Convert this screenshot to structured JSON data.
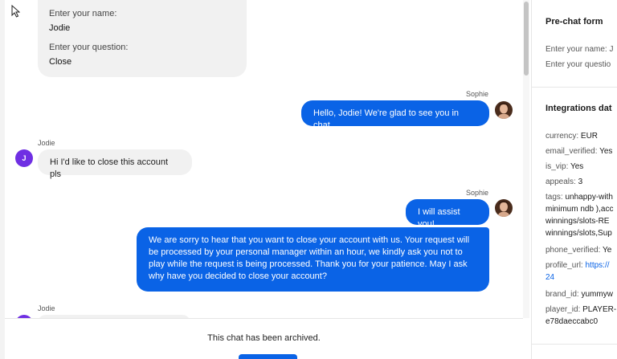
{
  "prechat_bubble": {
    "name_label": "Enter your name:",
    "name_value": "Jodie",
    "question_label": "Enter your question:",
    "question_value": "Close"
  },
  "messages": [
    {
      "sender": "Sophie",
      "text": "Hello, Jodie! We're glad to see you in chat."
    },
    {
      "sender": "Jodie",
      "avatar_letter": "J",
      "text": "Hi I'd like to close this account pls"
    },
    {
      "sender": "Sophie",
      "text": "I will assist you!"
    },
    {
      "text": "We are sorry to hear that you want to close your account with us. Your request will be processed by your personal manager within an hour, we kindly ask you not to play while the request is being processed. Thank you for your patience. May I ask why have you decided to close your account?"
    },
    {
      "sender": "Jodie"
    }
  ],
  "archived": {
    "text": "This chat has been archived."
  },
  "panel": {
    "prechat_title": "Pre-chat form",
    "prechat_lines": [
      "Enter your name: J",
      "Enter your questio"
    ],
    "integrations_title": "Integrations dat",
    "fields": [
      {
        "key": "currency:",
        "value": "EUR"
      },
      {
        "key": "email_verified:",
        "value": "Yes"
      },
      {
        "key": "is_vip:",
        "value": "Yes"
      },
      {
        "key": "appeals:",
        "value": "3"
      },
      {
        "key": "tags:",
        "value": "unhappy-with"
      }
    ],
    "tags_continuation": [
      "minimum ndb ),acc",
      "winnings/slots-RE",
      "winnings/slots,Sup"
    ],
    "phone_verified": {
      "key": "phone_verified:",
      "value": "Ye"
    },
    "profile_url": {
      "key": "profile_url:",
      "value": "https://",
      "cont": "24"
    },
    "brand_id": {
      "key": "brand_id:",
      "value": "yummyw"
    },
    "player_id": {
      "key": "player_id:",
      "value": "PLAYER-",
      "cont": "e78daeccabc0"
    }
  },
  "colors": {
    "accent": "#0a63e6",
    "avatar_j": "#6f2fe3",
    "bubble_in": "#f1f1f1"
  },
  "icons": [
    "cursor-icon",
    "avatar-sophie",
    "avatar-jodie"
  ]
}
